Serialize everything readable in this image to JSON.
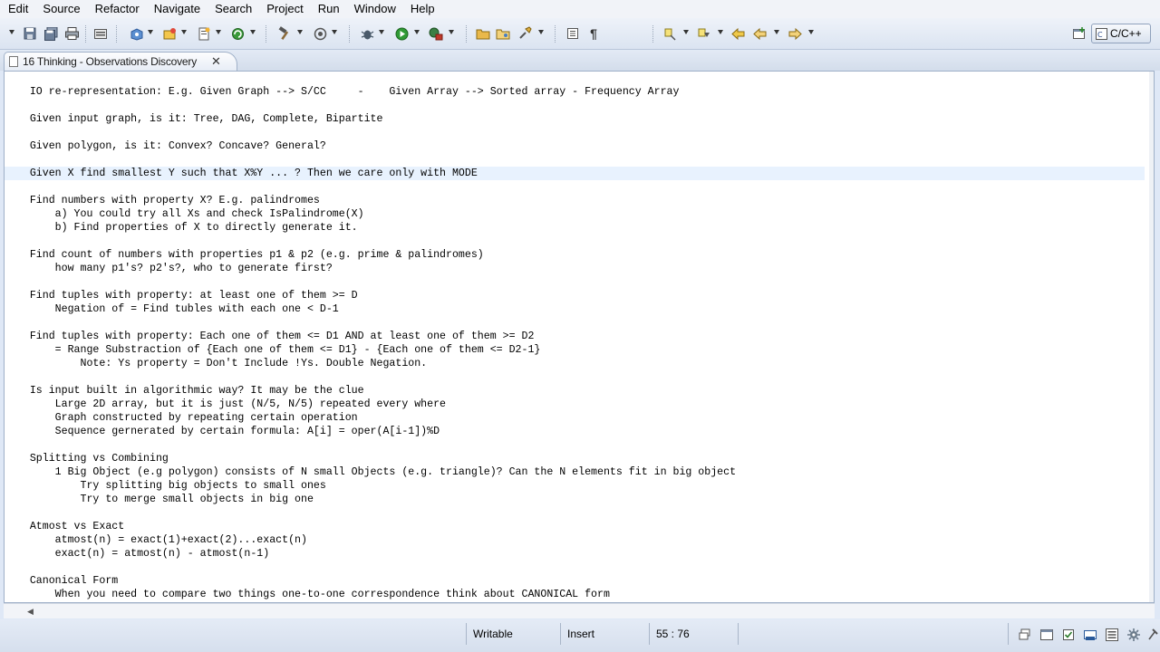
{
  "menu": {
    "items": [
      "Edit",
      "Source",
      "Refactor",
      "Navigate",
      "Search",
      "Project",
      "Run",
      "Window",
      "Help"
    ]
  },
  "toolbar": {
    "perspective_label": "C/C++",
    "icons": [
      "save-icon",
      "save-all-icon",
      "print-icon",
      "build-icon",
      "new-project-icon",
      "new-file-icon",
      "refresh-icon",
      "hammer-build-icon",
      "target-icon",
      "debug-icon",
      "run-icon",
      "external-tools-icon",
      "open-folder-icon",
      "open-type-icon",
      "search-icon",
      "toggle-block-icon",
      "show-whitespace-icon",
      "annotation-icon",
      "next-annotation-icon",
      "last-edit-icon",
      "back-icon",
      "forward-icon",
      "open-perspective-icon"
    ]
  },
  "editor": {
    "tab_title": "16 Thinking - Observations Discovery",
    "current_line_index": 6,
    "lines": [
      "    IO re-representation: E.g. Given Graph --> S/CC     -    Given Array --> Sorted array - Frequency Array",
      "",
      "    Given input graph, is it: Tree, DAG, Complete, Bipartite",
      "",
      "    Given polygon, is it: Convex? Concave? General?",
      "",
      "    Given X find smallest Y such that X%Y ... ? Then we care only with MODE",
      "",
      "    Find numbers with property X? E.g. palindromes",
      "        a) You could try all Xs and check IsPalindrome(X)",
      "        b) Find properties of X to directly generate it.",
      "",
      "    Find count of numbers with properties p1 & p2 (e.g. prime & palindromes)",
      "        how many p1's? p2's?, who to generate first?",
      "",
      "    Find tuples with property: at least one of them >= D",
      "        Negation of = Find tubles with each one < D-1",
      "",
      "    Find tuples with property: Each one of them <= D1 AND at least one of them >= D2",
      "        = Range Substraction of {Each one of them <= D1} - {Each one of them <= D2-1}",
      "            Note: Ys property = Don't Include !Ys. Double Negation.",
      "",
      "    Is input built in algorithmic way? It may be the clue",
      "        Large 2D array, but it is just (N/5, N/5) repeated every where",
      "        Graph constructed by repeating certain operation",
      "        Sequence gernerated by certain formula: A[i] = oper(A[i-1])%D",
      "",
      "    Splitting vs Combining",
      "        1 Big Object (e.g polygon) consists of N small Objects (e.g. triangle)? Can the N elements fit in big object",
      "            Try splitting big objects to small ones",
      "            Try to merge small objects in big one",
      "",
      "    Atmost vs Exact",
      "        atmost(n) = exact(1)+exact(2)...exact(n)",
      "        exact(n) = atmost(n) - atmost(n-1)",
      "",
      "    Canonical Form",
      "        When you need to compare two things one-to-one correspondence think about CANONICAL form"
    ]
  },
  "status": {
    "writable": "Writable",
    "insert_mode": "Insert",
    "position": "55 : 76"
  },
  "colors": {
    "current_line": "#e8f2fe",
    "chrome_background": "#dfe8f6"
  }
}
